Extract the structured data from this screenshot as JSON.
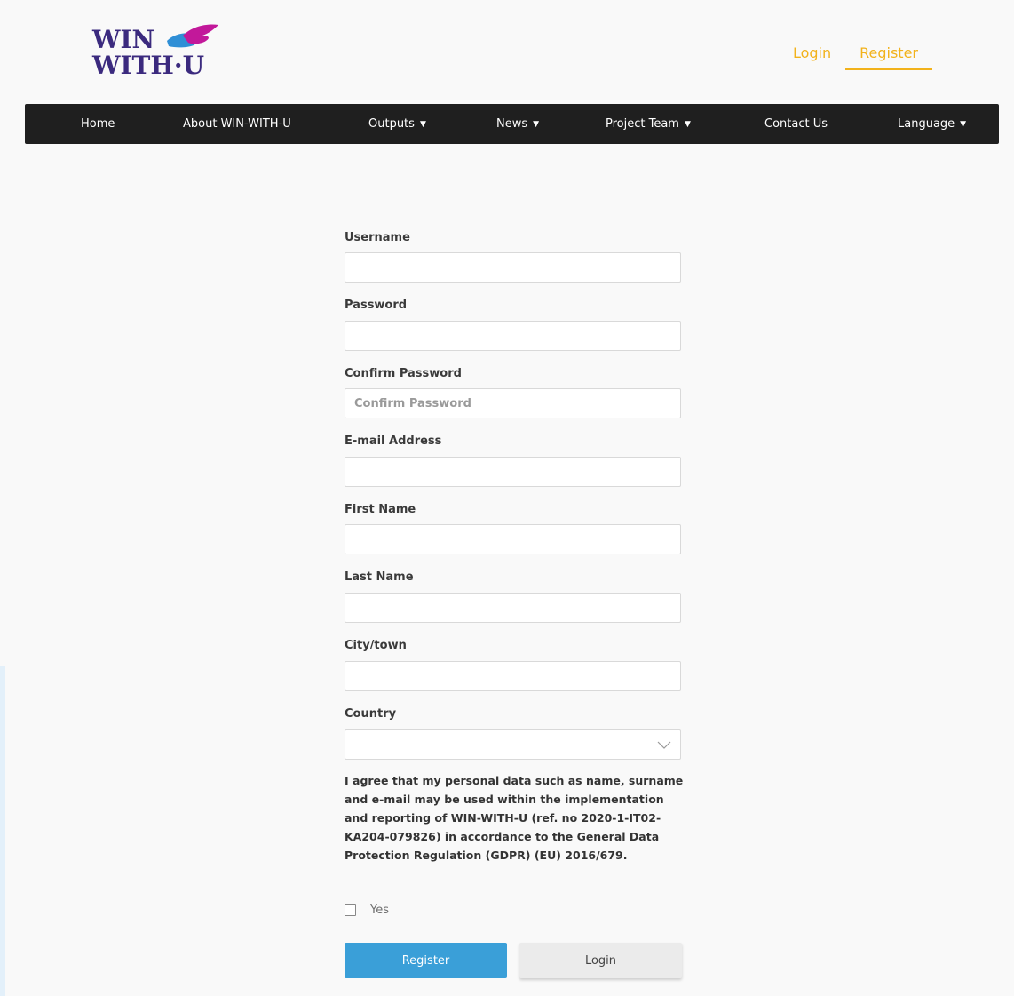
{
  "brand": {
    "line1": "WIN",
    "line2": "WITH·U"
  },
  "top_links": {
    "login": "Login",
    "register": "Register"
  },
  "nav": {
    "home": "Home",
    "about": "About WIN-WITH-U",
    "outputs": "Outputs",
    "news": "News",
    "team": "Project Team",
    "contact": "Contact Us",
    "language": "Language",
    "caret": "▼"
  },
  "form": {
    "username_label": "Username",
    "username_value": "",
    "password_label": "Password",
    "password_value": "",
    "confirm_label": "Confirm Password",
    "confirm_placeholder": "Confirm Password",
    "email_label": "E-mail Address",
    "email_value": "",
    "first_name_label": "First Name",
    "first_name_value": "",
    "last_name_label": "Last Name",
    "last_name_value": "",
    "city_label": "City/town",
    "city_value": "",
    "country_label": "Country",
    "country_selected": "",
    "consent_text": "I agree that my personal data such as name, surname and e-mail may be used within the implementation and reporting of WIN-WITH-U (ref. no 2020-1-IT02-KA204-079826) in accordance to the General Data Protection Regulation (GDPR) (EU) 2016/679.",
    "consent_checkbox_label": "Yes",
    "consent_checked": false,
    "register_button": "Register",
    "login_button": "Login"
  },
  "colors": {
    "accent_yellow": "#f2b21b",
    "nav_bg": "#1f1f1f",
    "primary_blue": "#3a9fd8",
    "logo_purple": "#3b2a7e",
    "logo_magenta": "#c2189a",
    "logo_blue": "#2f8fd6"
  }
}
